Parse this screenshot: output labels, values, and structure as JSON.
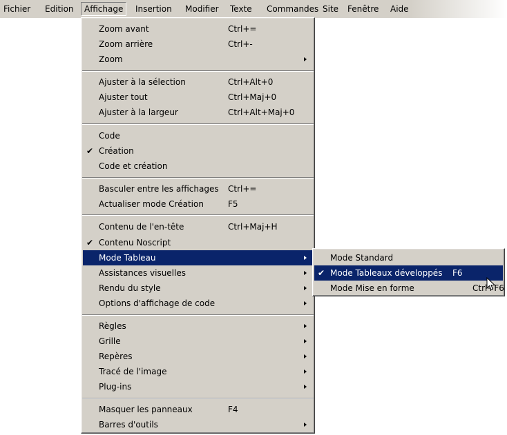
{
  "menubar": {
    "items": [
      {
        "label": "Fichier"
      },
      {
        "label": "Edition"
      },
      {
        "label": "Affichage"
      },
      {
        "label": "Insertion"
      },
      {
        "label": "Modifier"
      },
      {
        "label": "Texte"
      },
      {
        "label": "Commandes"
      },
      {
        "label": "Site"
      },
      {
        "label": "Fenêtre"
      },
      {
        "label": "Aide"
      }
    ]
  },
  "view_menu": {
    "items": [
      {
        "label": "Zoom avant",
        "shortcut": "Ctrl+="
      },
      {
        "label": "Zoom arrière",
        "shortcut": "Ctrl+-"
      },
      {
        "label": "Zoom",
        "submenu": true
      },
      {
        "label": "Ajuster à la sélection",
        "shortcut": "Ctrl+Alt+0"
      },
      {
        "label": "Ajuster tout",
        "shortcut": "Ctrl+Maj+0"
      },
      {
        "label": "Ajuster à la largeur",
        "shortcut": "Ctrl+Alt+Maj+0"
      },
      {
        "label": "Code"
      },
      {
        "label": "Création",
        "checked": "✔"
      },
      {
        "label": "Code et création"
      },
      {
        "label": "Basculer entre les affichages",
        "shortcut": "Ctrl+="
      },
      {
        "label": "Actualiser mode Création",
        "shortcut": "F5"
      },
      {
        "label": "Contenu de l'en-tête",
        "shortcut": "Ctrl+Maj+H"
      },
      {
        "label": "Contenu Noscript",
        "checked": "✔"
      },
      {
        "label": "Mode Tableau",
        "submenu": true,
        "highlighted": true
      },
      {
        "label": "Assistances visuelles",
        "submenu": true
      },
      {
        "label": "Rendu du style",
        "submenu": true
      },
      {
        "label": "Options d'affichage de code",
        "submenu": true
      },
      {
        "label": "Règles",
        "submenu": true
      },
      {
        "label": "Grille",
        "submenu": true
      },
      {
        "label": "Repères",
        "submenu": true
      },
      {
        "label": "Tracé de l'image",
        "submenu": true
      },
      {
        "label": "Plug-ins",
        "submenu": true
      },
      {
        "label": "Masquer les panneaux",
        "shortcut": "F4"
      },
      {
        "label": "Barres d'outils",
        "submenu": true
      }
    ]
  },
  "table_mode_submenu": {
    "items": [
      {
        "label": "Mode Standard"
      },
      {
        "label": "Mode Tableaux développés",
        "shortcut": "F6",
        "checked": "✔",
        "highlighted": true
      },
      {
        "label": "Mode Mise en forme",
        "shortcut": "Ctrl+F6"
      }
    ]
  },
  "colors": {
    "menu_bg": "#d4d0c8",
    "highlight_bg": "#0a246a",
    "highlight_text": "#ffffff"
  }
}
